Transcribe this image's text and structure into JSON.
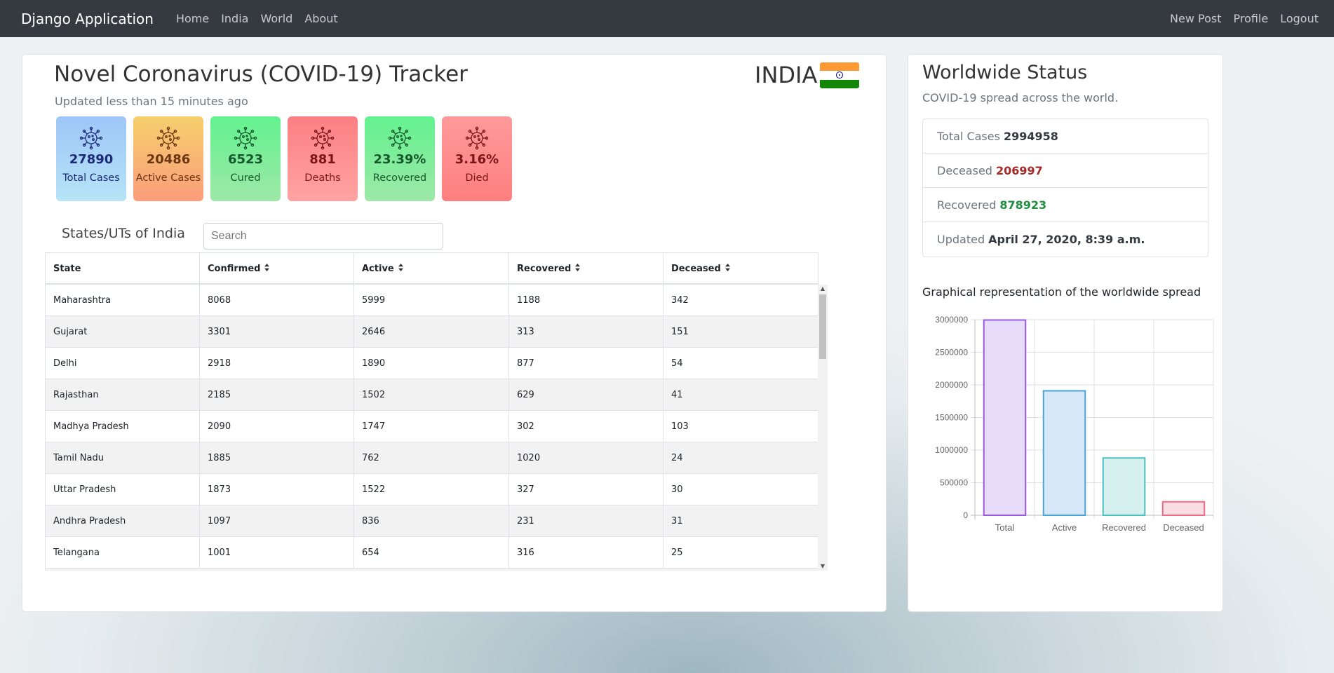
{
  "nav": {
    "brand": "Django Application",
    "left": [
      "Home",
      "India",
      "World",
      "About"
    ],
    "right": [
      "New Post",
      "Profile",
      "Logout"
    ]
  },
  "main": {
    "title": "Novel Coronavirus (COVID-19) Tracker",
    "subtitle": "Updated less than 15 minutes ago",
    "country": "INDIA",
    "tiles": [
      {
        "value": "27890",
        "label": "Total Cases",
        "bg": "linear-gradient(180deg,#9ec6f7,#b7e4f7)",
        "color": "#1d2a7a"
      },
      {
        "value": "20486",
        "label": "Active Cases",
        "bg": "linear-gradient(180deg,#f6cf6c,#fb9d7c)",
        "color": "#6b3510"
      },
      {
        "value": "6523",
        "label": "Cured",
        "bg": "linear-gradient(180deg,#63f28f,#9ee8a8)",
        "color": "#15582b"
      },
      {
        "value": "881",
        "label": "Deaths",
        "bg": "linear-gradient(180deg,#fb7f82,#ffa3a3)",
        "color": "#7a1517"
      },
      {
        "value": "23.39%",
        "label": "Recovered",
        "bg": "linear-gradient(180deg,#63f28f,#9ee8a8)",
        "color": "#15582b"
      },
      {
        "value": "3.16%",
        "label": "Died",
        "bg": "linear-gradient(180deg,#ff9a9a,#fd7f7f)",
        "color": "#7a1517"
      }
    ],
    "states_title": "States/UTs of India",
    "search_placeholder": "Search",
    "table": {
      "headers": [
        "State",
        "Confirmed",
        "Active",
        "Recovered",
        "Deceased"
      ],
      "sortable": [
        false,
        true,
        true,
        true,
        true
      ],
      "rows": [
        [
          "Maharashtra",
          "8068",
          "5999",
          "1188",
          "342"
        ],
        [
          "Gujarat",
          "3301",
          "2646",
          "313",
          "151"
        ],
        [
          "Delhi",
          "2918",
          "1890",
          "877",
          "54"
        ],
        [
          "Rajasthan",
          "2185",
          "1502",
          "629",
          "41"
        ],
        [
          "Madhya Pradesh",
          "2090",
          "1747",
          "302",
          "103"
        ],
        [
          "Tamil Nadu",
          "1885",
          "762",
          "1020",
          "24"
        ],
        [
          "Uttar Pradesh",
          "1873",
          "1522",
          "327",
          "30"
        ],
        [
          "Andhra Pradesh",
          "1097",
          "836",
          "231",
          "31"
        ],
        [
          "Telangana",
          "1001",
          "654",
          "316",
          "25"
        ]
      ]
    }
  },
  "side": {
    "title": "Worldwide Status",
    "subtitle": "COVID-19 spread across the world.",
    "items": [
      {
        "label": "Total Cases",
        "value": "2994958"
      },
      {
        "label": "Deceased",
        "value": "206997"
      },
      {
        "label": "Recovered",
        "value": "878923"
      },
      {
        "label": "Updated",
        "value": "April 27, 2020, 8:39 a.m."
      }
    ],
    "graph_title": "Graphical representation of the worldwide spread"
  },
  "chart_data": {
    "type": "bar",
    "categories": [
      "Total",
      "Active",
      "Recovered",
      "Deceased"
    ],
    "values": [
      2994958,
      1909038,
      878923,
      206997
    ],
    "ylim": [
      0,
      3000000
    ],
    "yticks": [
      0,
      500000,
      1000000,
      1500000,
      2000000,
      2500000,
      3000000
    ],
    "grid": true,
    "colors": {
      "fill": [
        "#e8dcfb",
        "#d6e8f7",
        "#d6f0f0",
        "#fbdde4"
      ],
      "stroke": [
        "#9b59e3",
        "#4aa3d9",
        "#4cc0bf",
        "#f06b8b"
      ]
    }
  }
}
